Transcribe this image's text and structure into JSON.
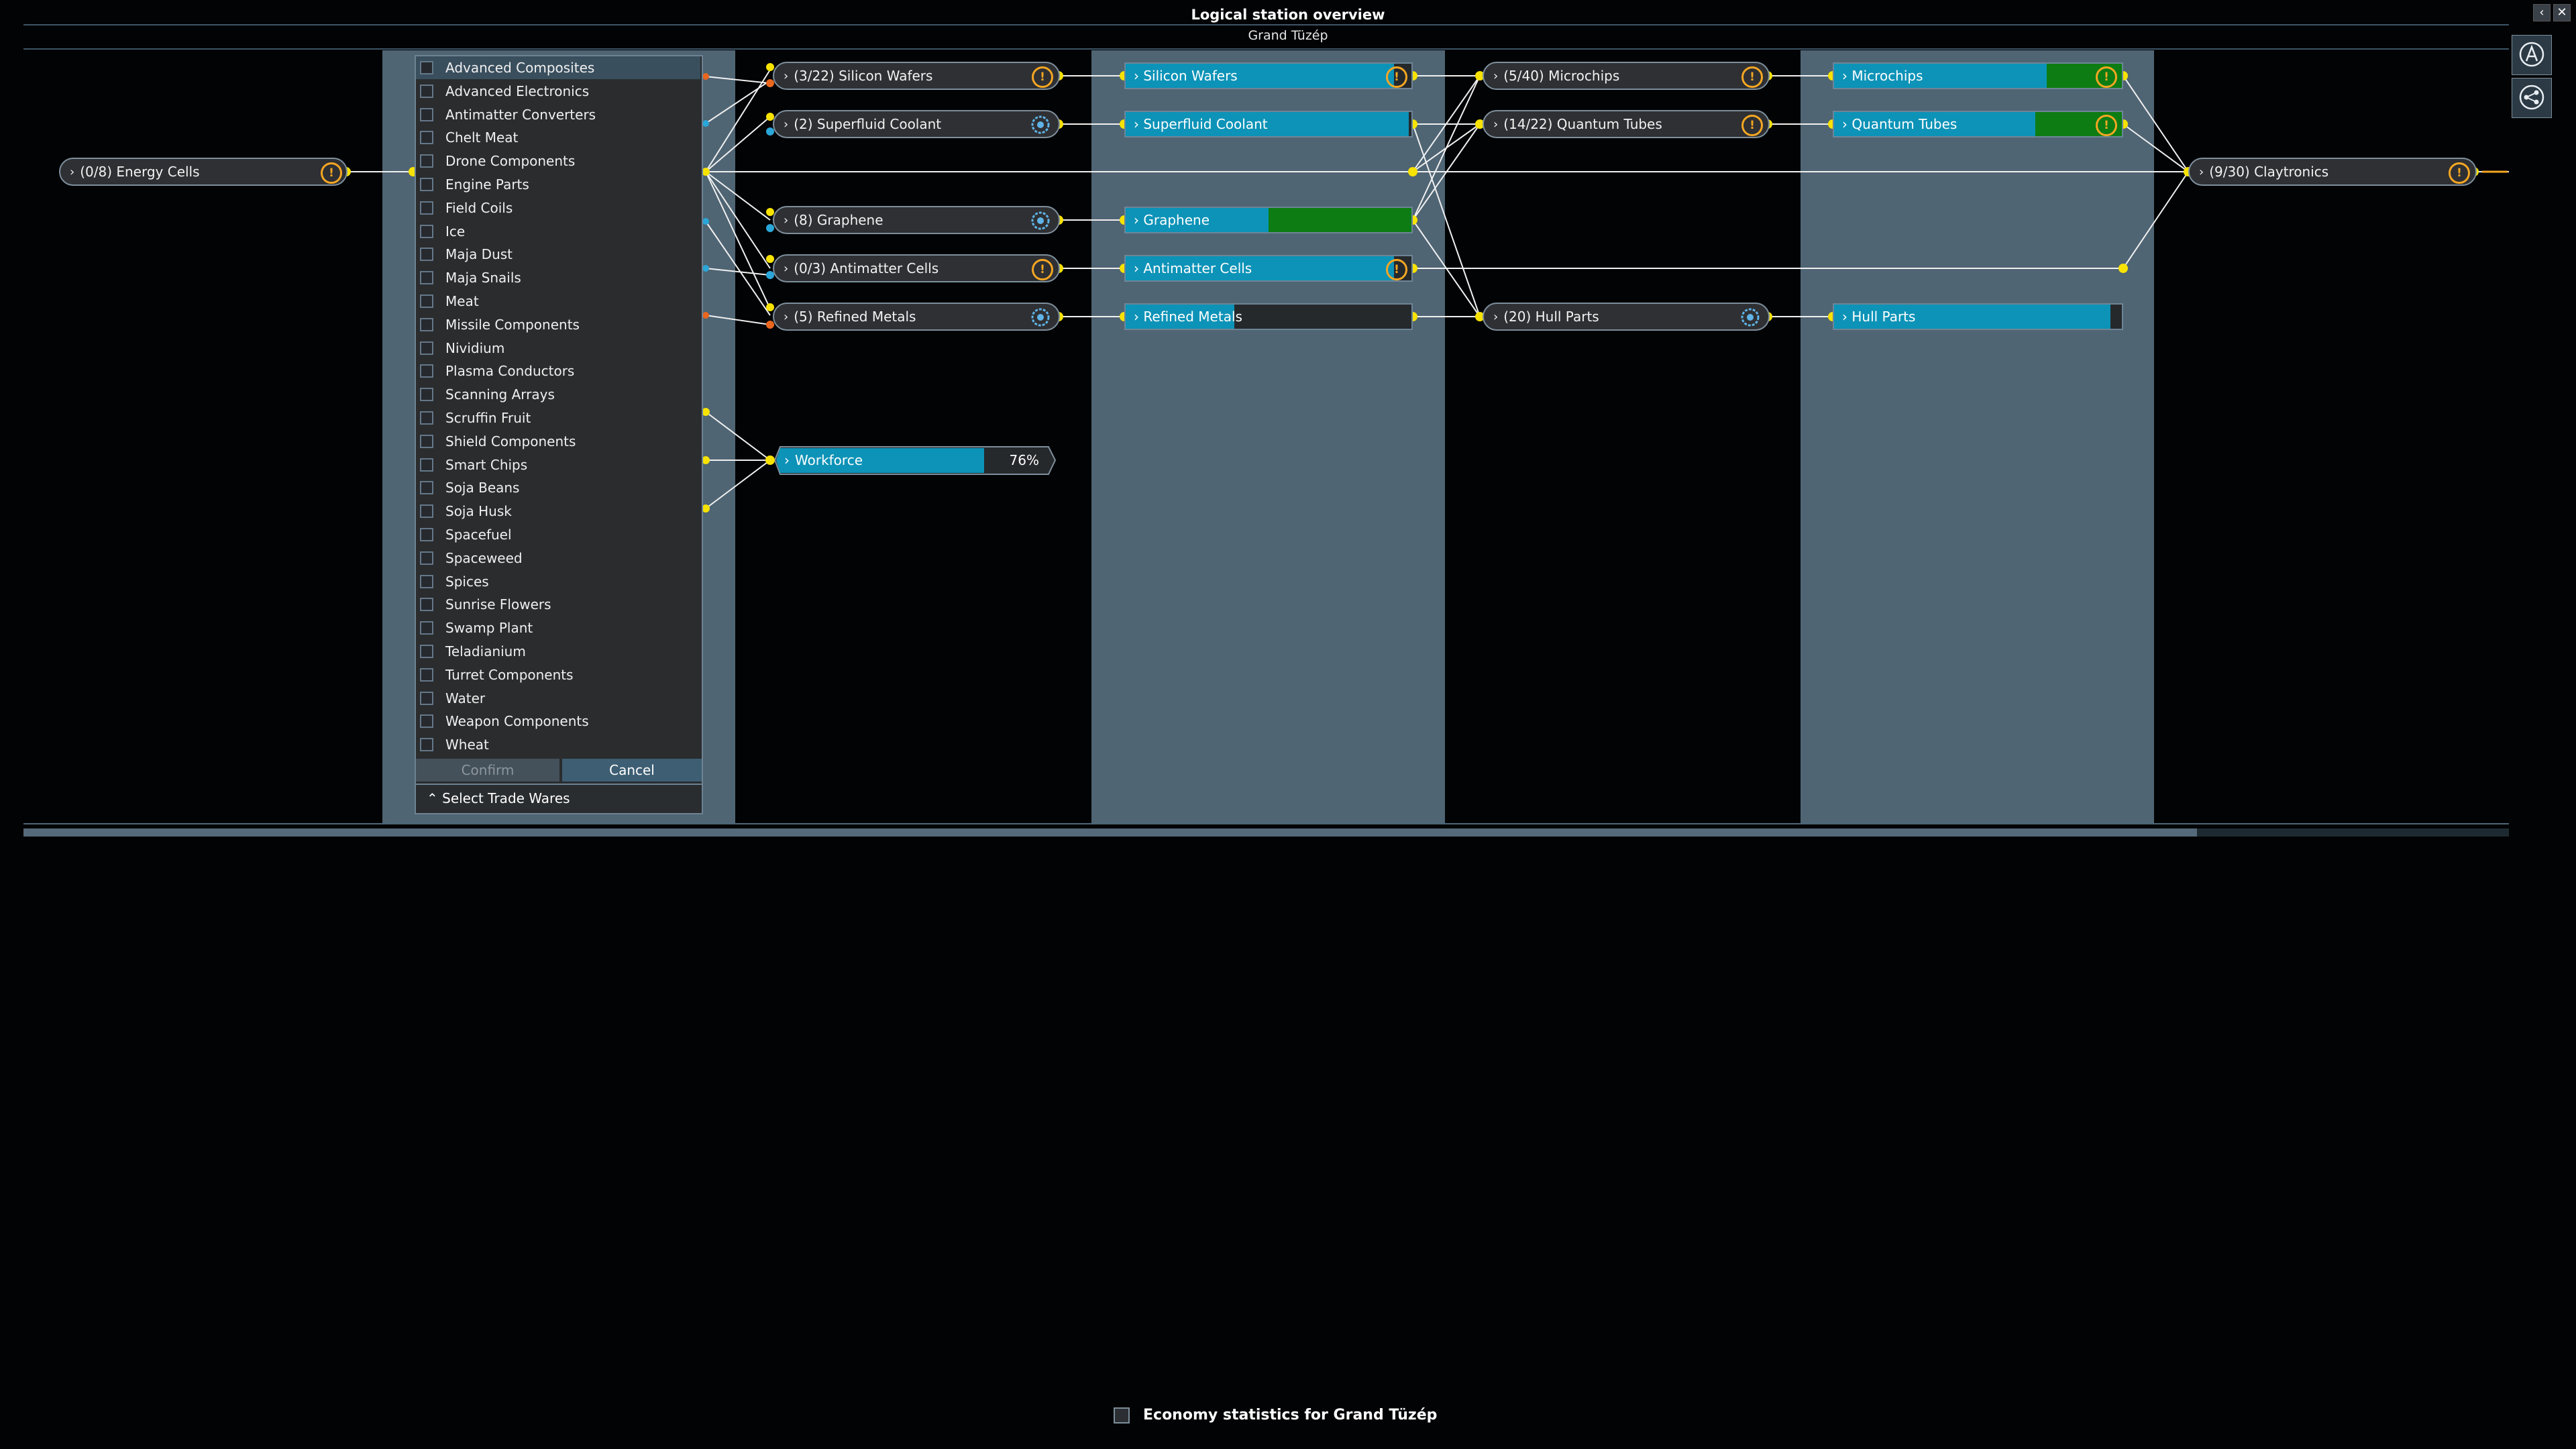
{
  "window": {
    "title": "Logical station overview",
    "subtitle": "Grand Tüzép",
    "back_glyph": "‹",
    "close_glyph": "✕"
  },
  "sidebar_buttons": [
    {
      "icon": "autopilot-a-icon"
    },
    {
      "icon": "network-share-icon"
    }
  ],
  "modules": {
    "energy_cells": "(0/8) Energy Cells",
    "silicon_wafers": "(3/22) Silicon Wafers",
    "superfluid_coolant": "(2) Superfluid Coolant",
    "graphene": "(8) Graphene",
    "antimatter_cells": "(0/3) Antimatter Cells",
    "refined_metals": "(5) Refined Metals",
    "microchips": "(5/40) Microchips",
    "quantum_tubes": "(14/22) Quantum Tubes",
    "hull_parts": "(20) Hull Parts",
    "claytronics": "(9/30) Claytronics"
  },
  "storage": {
    "silicon_wafers": {
      "label": "Silicon Wafers",
      "fill": 0.94,
      "green": 0.0
    },
    "superfluid_coolant": {
      "label": "Superfluid Coolant",
      "fill": 0.99,
      "green": 0.0
    },
    "graphene": {
      "label": "Graphene",
      "fill": 0.5,
      "green": 0.5
    },
    "antimatter_cells": {
      "label": "Antimatter Cells",
      "fill": 0.94,
      "green": 0.0
    },
    "refined_metals": {
      "label": "Refined Metals",
      "fill": 0.38,
      "green": 0.0
    },
    "microchips": {
      "label": "Microchips",
      "fill": 0.74,
      "green": 0.26
    },
    "quantum_tubes": {
      "label": "Quantum Tubes",
      "fill": 0.7,
      "green": 0.3
    },
    "hull_parts": {
      "label": "Hull Parts",
      "fill": 0.96,
      "green": 0.0
    }
  },
  "workforce": {
    "label": "Workforce",
    "percent_text": "76%",
    "fill": 0.76
  },
  "trade_wares": {
    "items": [
      "Advanced Composites",
      "Advanced Electronics",
      "Antimatter Converters",
      "Chelt Meat",
      "Drone Components",
      "Engine Parts",
      "Field Coils",
      "Ice",
      "Maja Dust",
      "Maja Snails",
      "Meat",
      "Missile Components",
      "Nividium",
      "Plasma Conductors",
      "Scanning Arrays",
      "Scruffin Fruit",
      "Shield Components",
      "Smart Chips",
      "Soja Beans",
      "Soja Husk",
      "Spacefuel",
      "Spaceweed",
      "Spices",
      "Sunrise Flowers",
      "Swamp Plant",
      "Teladianium",
      "Turret Components",
      "Water",
      "Weapon Components",
      "Wheat"
    ],
    "confirm_label": "Confirm",
    "cancel_label": "Cancel",
    "select_label": "Select Trade Wares"
  },
  "footer": {
    "economy_label": "Economy statistics for Grand Tüzép"
  },
  "colors": {
    "wire": "#f0f0f0",
    "node_yellow": "#f7e200",
    "warning": "#f5a623",
    "storage_blue": "#0e93b8",
    "surplus_green": "#0d7c12",
    "column_bg": "#506574"
  }
}
